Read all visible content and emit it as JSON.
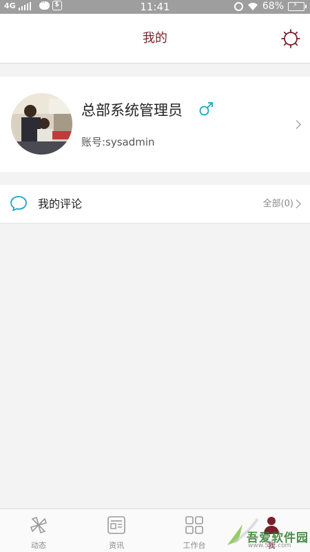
{
  "status_bar": {
    "network": "4G",
    "time": "11:41",
    "battery": "68%"
  },
  "header": {
    "title": "我的",
    "settings_icon": "gear-icon"
  },
  "profile": {
    "name": "总部系统管理员",
    "gender_icon": "male-icon",
    "account": "账号:sysadmin"
  },
  "comments": {
    "label": "我的评论",
    "all_label": "全部(0)",
    "icon": "speech-bubble-icon"
  },
  "tabbar": {
    "tabs": [
      {
        "label": "动态",
        "icon": "pinwheel-icon"
      },
      {
        "label": "资讯",
        "icon": "news-icon"
      },
      {
        "label": "工作台",
        "icon": "grid-icon"
      },
      {
        "label": "我",
        "icon": "person-icon"
      }
    ],
    "active_index": 3
  },
  "watermark": {
    "text": "吾爱软件园",
    "url": "www.52z.com"
  },
  "colors": {
    "accent": "#7a1f2b",
    "teal": "#1fa3c6",
    "background": "#f3f3f3"
  }
}
